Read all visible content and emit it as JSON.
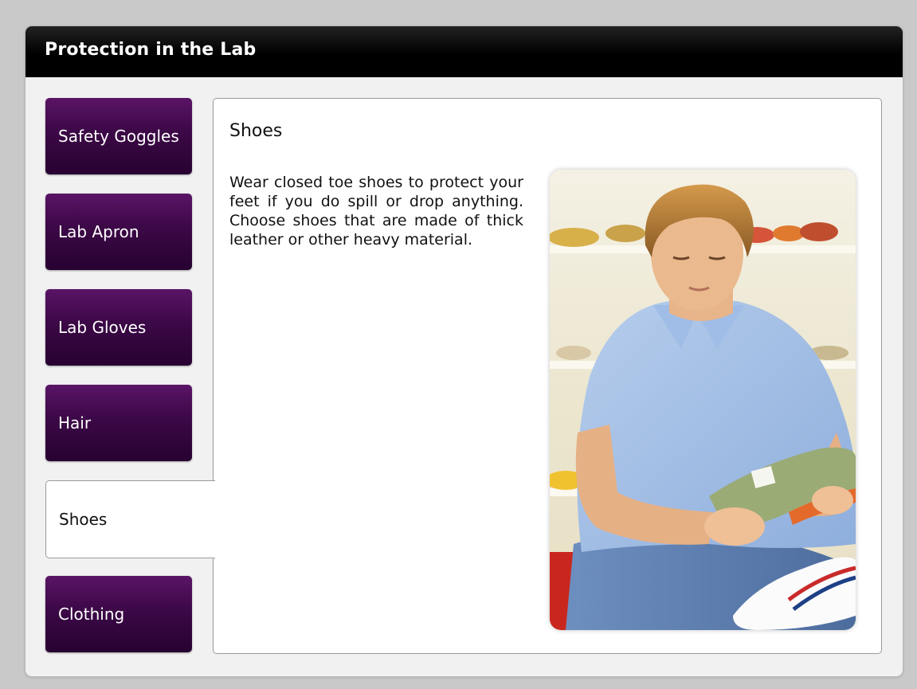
{
  "window": {
    "title": "Protection in the Lab"
  },
  "tabs": [
    {
      "label": "Safety Goggles"
    },
    {
      "label": "Lab Apron"
    },
    {
      "label": "Lab Gloves"
    },
    {
      "label": "Hair"
    },
    {
      "label": "Shoes"
    },
    {
      "label": "Clothing"
    }
  ],
  "active_tab": "Shoes",
  "content": {
    "title": "Shoes",
    "body": "Wear closed toe shoes to protect your feet if you do spill or drop anything. Choose shoes that are made of thick leather or other heavy material.",
    "image_icon": "photo-man-holding-shoe"
  },
  "colors": {
    "background": "#c9c9c9",
    "titlebar": "#000000",
    "tab_purple": "#3c0846",
    "panel": "#ffffff"
  }
}
